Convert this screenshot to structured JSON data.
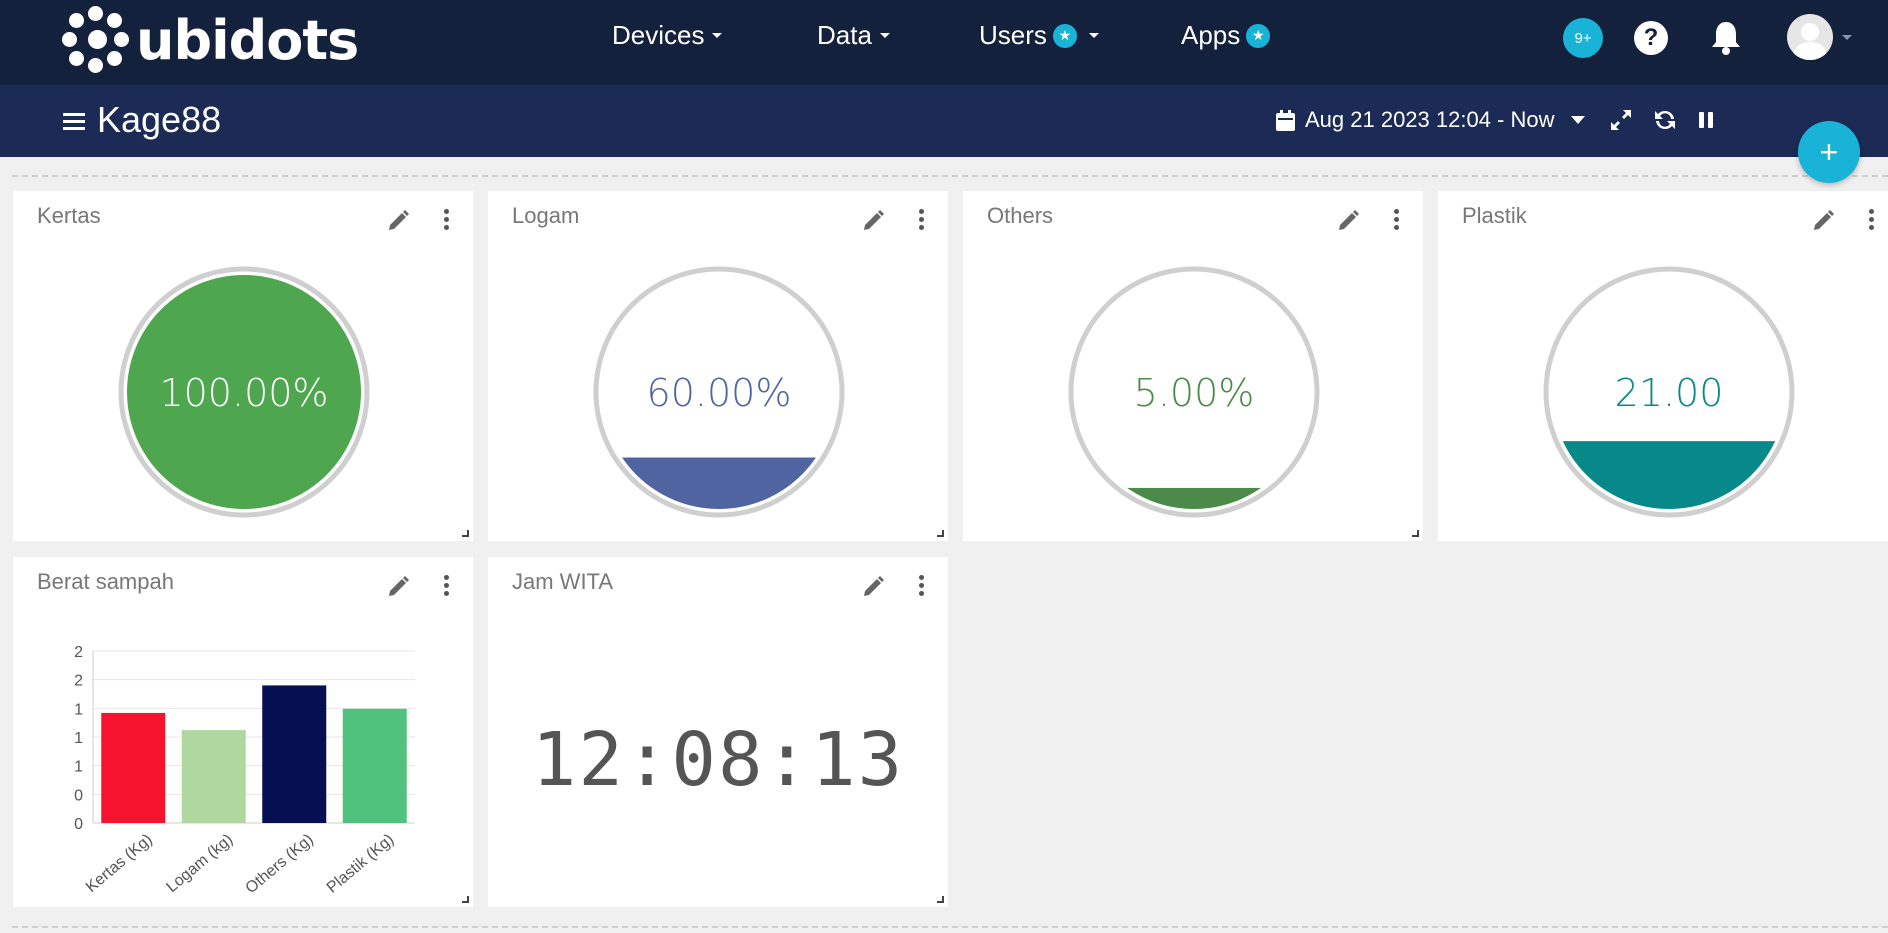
{
  "nav": {
    "logo_text": "ubidots",
    "items": [
      {
        "label": "Devices",
        "has_star": false,
        "has_caret": true
      },
      {
        "label": "Data",
        "has_star": false,
        "has_caret": true
      },
      {
        "label": "Users",
        "has_star": true,
        "has_caret": true
      },
      {
        "label": "Apps",
        "has_star": true,
        "has_caret": false
      }
    ],
    "notifications_badge": "9+",
    "help_label": "?",
    "accent_color": "#1ab3d8"
  },
  "dashboard": {
    "title": "Kage88",
    "date_range": "Aug 21 2023 12:04 - Now",
    "fab_label": "+"
  },
  "widgets": {
    "kertas": {
      "title": "Kertas",
      "value": "100.00%",
      "fill": 1.0,
      "color": "#4ea64e",
      "text_color": "#ffffff"
    },
    "logam": {
      "title": "Logam",
      "value": "60.00%",
      "fill": 0.22,
      "color": "#4f64a0",
      "text_color": "#4f64a0"
    },
    "others": {
      "title": "Others",
      "value": "5.00%",
      "fill": 0.09,
      "color": "#4b8a48",
      "text_color": "#4b8a48"
    },
    "plastik": {
      "title": "Plastik",
      "value": "21.00",
      "fill": 0.29,
      "color": "#07898a",
      "text_color": "#07898a"
    },
    "berat": {
      "title": "Berat sampah"
    },
    "jam": {
      "title": "Jam WITA",
      "time": "12:08:13"
    }
  },
  "chart_data": {
    "type": "bar",
    "categories": [
      "Kertas (Kg)",
      "Logam (kg)",
      "Others (Kg)",
      "Plastik (Kg)"
    ],
    "values": [
      1.6,
      1.35,
      2.0,
      1.66
    ],
    "colors": [
      "#f5132d",
      "#b0d7a0",
      "#050f52",
      "#50c27d"
    ],
    "ytick_labels": [
      "0",
      "0",
      "1",
      "1",
      "1",
      "2",
      "2"
    ],
    "ylim": [
      0,
      2.5
    ],
    "grid": true
  }
}
